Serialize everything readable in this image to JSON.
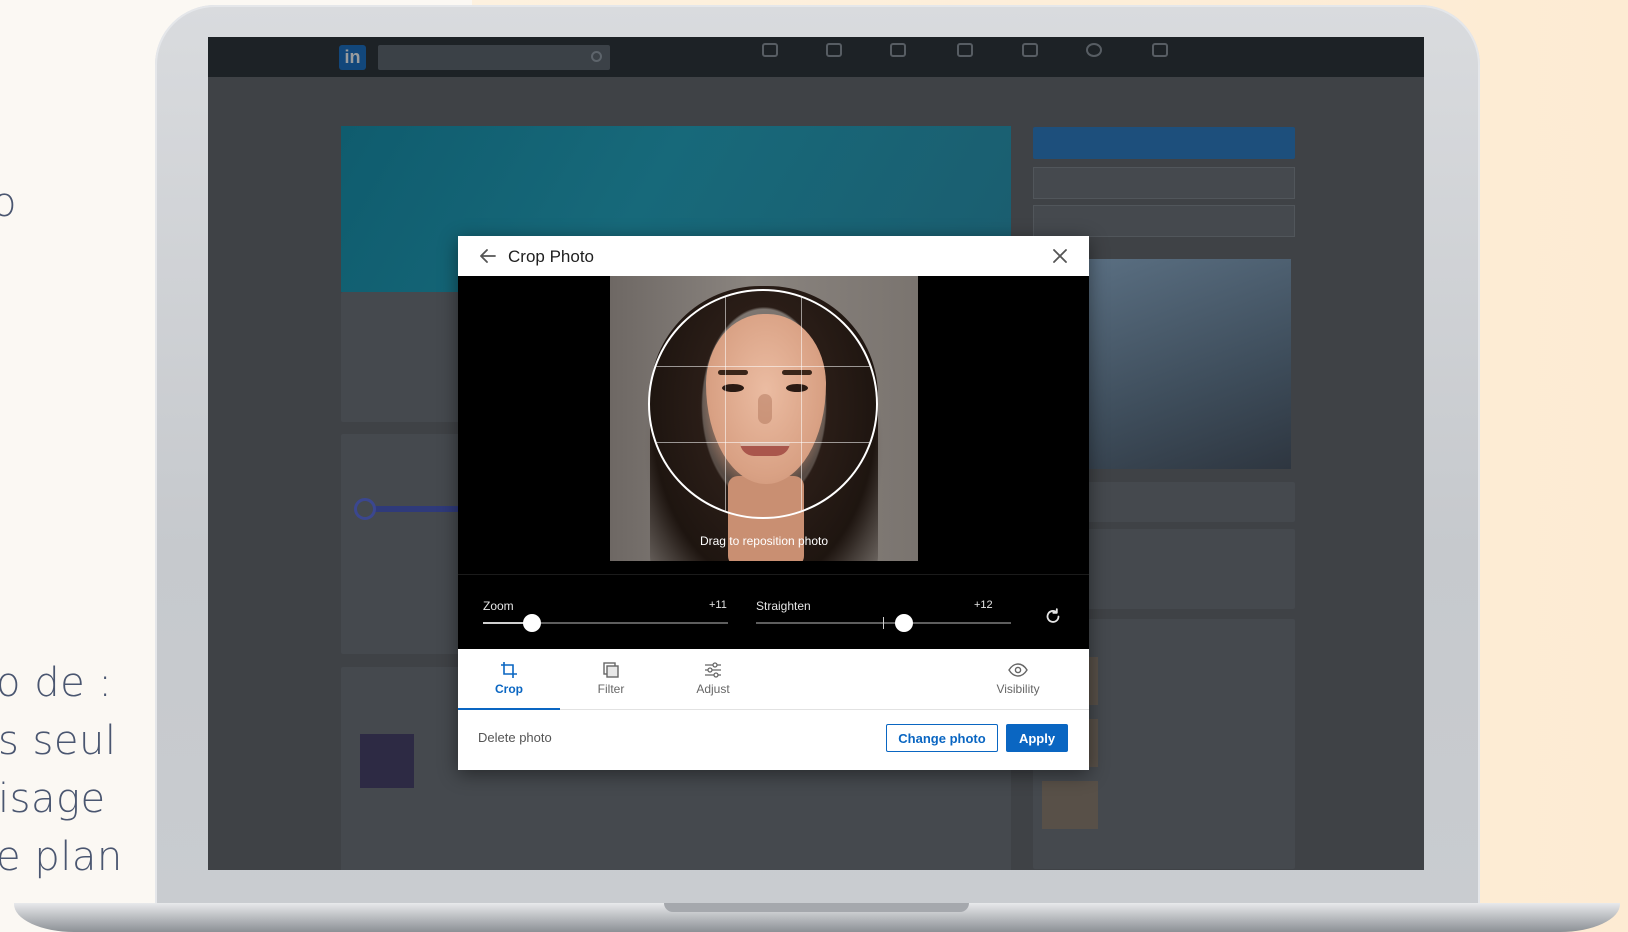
{
  "slide": {
    "fragment_top": "o",
    "lines": [
      "o de :",
      "s seul",
      "isage",
      "e plan"
    ]
  },
  "background_app": {
    "brand_color": "#0a66c2",
    "logo": "in",
    "nav_icons": [
      "home-icon",
      "network-icon",
      "jobs-icon",
      "messaging-icon",
      "notifications-icon",
      "me-icon",
      "work-icon"
    ]
  },
  "modal": {
    "title": "Crop Photo",
    "back_icon": "arrow-left-icon",
    "close_icon": "close-icon",
    "drag_hint": "Drag to reposition photo",
    "zoom": {
      "label": "Zoom",
      "value_text": "+11",
      "fraction": 0.2
    },
    "straighten": {
      "label": "Straighten",
      "value_text": "+12",
      "fraction": 0.58
    },
    "reset_icon": "rotate-reset-icon",
    "tabs": [
      {
        "label": "Crop",
        "icon": "crop-icon",
        "active": true
      },
      {
        "label": "Filter",
        "icon": "filter-icon",
        "active": false
      },
      {
        "label": "Adjust",
        "icon": "sliders-icon",
        "active": false
      },
      {
        "label": "Visibility",
        "icon": "eye-icon",
        "active": false
      }
    ],
    "delete_label": "Delete photo",
    "change_label": "Change photo",
    "apply_label": "Apply"
  }
}
